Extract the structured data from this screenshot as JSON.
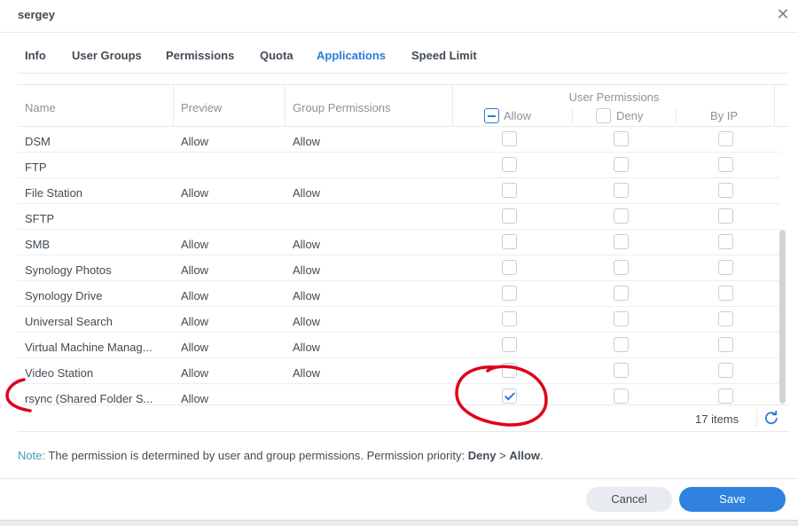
{
  "window": {
    "title": "sergey"
  },
  "tabs": [
    {
      "label": "Info"
    },
    {
      "label": "User Groups"
    },
    {
      "label": "Permissions"
    },
    {
      "label": "Quota"
    },
    {
      "label": "Applications"
    },
    {
      "label": "Speed Limit"
    }
  ],
  "active_tab": "Applications",
  "table": {
    "headers": {
      "name": "Name",
      "preview": "Preview",
      "group_permissions": "Group Permissions",
      "user_permissions": "User Permissions",
      "allow": "Allow",
      "deny": "Deny",
      "by_ip": "By IP"
    },
    "allow_header_state": "partial",
    "rows": [
      {
        "name": "DSM",
        "preview": "Allow",
        "group": "Allow",
        "allow": false,
        "deny": false,
        "by_ip": false
      },
      {
        "name": "FTP",
        "preview": "",
        "group": "",
        "allow": false,
        "deny": false,
        "by_ip": false
      },
      {
        "name": "File Station",
        "preview": "Allow",
        "group": "Allow",
        "allow": false,
        "deny": false,
        "by_ip": false
      },
      {
        "name": "SFTP",
        "preview": "",
        "group": "",
        "allow": false,
        "deny": false,
        "by_ip": false
      },
      {
        "name": "SMB",
        "preview": "Allow",
        "group": "Allow",
        "allow": false,
        "deny": false,
        "by_ip": false
      },
      {
        "name": "Synology Photos",
        "preview": "Allow",
        "group": "Allow",
        "allow": false,
        "deny": false,
        "by_ip": false
      },
      {
        "name": "Synology Drive",
        "preview": "Allow",
        "group": "Allow",
        "allow": false,
        "deny": false,
        "by_ip": false
      },
      {
        "name": "Universal Search",
        "preview": "Allow",
        "group": "Allow",
        "allow": false,
        "deny": false,
        "by_ip": false
      },
      {
        "name": "Virtual Machine Manag...",
        "preview": "Allow",
        "group": "Allow",
        "allow": false,
        "deny": false,
        "by_ip": false
      },
      {
        "name": "Video Station",
        "preview": "Allow",
        "group": "Allow",
        "allow": false,
        "deny": false,
        "by_ip": false
      },
      {
        "name": "rsync (Shared Folder S...",
        "preview": "Allow",
        "group": "",
        "allow": true,
        "deny": false,
        "by_ip": false
      }
    ],
    "item_count": "17 items"
  },
  "note": {
    "label": "Note:",
    "text": " The permission is determined by user and group permissions. Permission priority: ",
    "deny": "Deny",
    "gt": " > ",
    "allow": "Allow",
    "end": "."
  },
  "buttons": {
    "cancel": "Cancel",
    "save": "Save"
  },
  "colors": {
    "accent": "#2b7ad9",
    "save_bg": "#2f82e0",
    "annotation": "#e0001a",
    "note_label": "#3da0b4"
  },
  "icons": {
    "close": "close-icon",
    "refresh": "refresh-icon"
  }
}
